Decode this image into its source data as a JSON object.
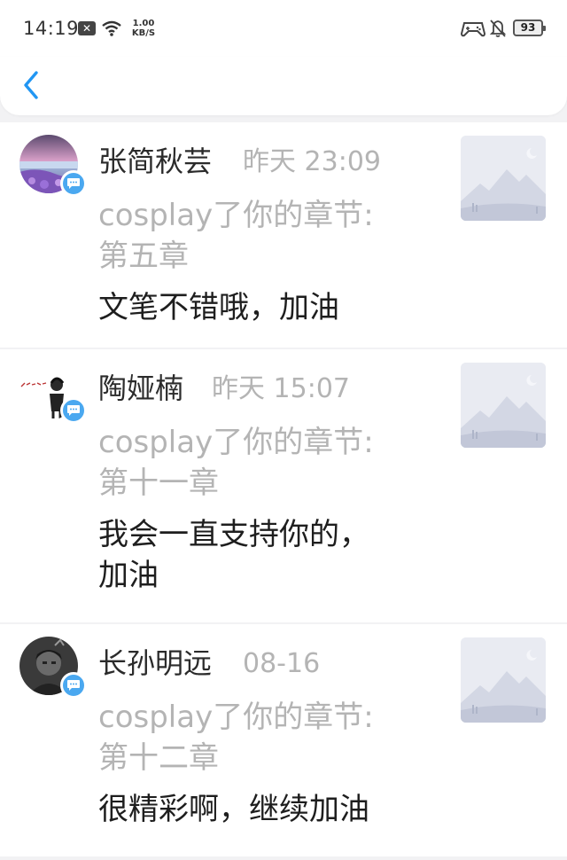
{
  "status_bar": {
    "time": "14:19",
    "speed_value": "1.00",
    "speed_unit": "KB/S",
    "battery": "93"
  },
  "notifications": [
    {
      "name": "张简秋芸",
      "time": "昨天 23:09",
      "action_line1": "cosplay了你的章节:",
      "action_line2": "第五章",
      "comment_line1": "文笔不错哦，加油",
      "comment_line2": ""
    },
    {
      "name": "陶娅楠",
      "time": "昨天 15:07",
      "action_line1": "cosplay了你的章节:",
      "action_line2": "第十一章",
      "comment_line1": "我会一直支持你的，",
      "comment_line2": "加油"
    },
    {
      "name": "长孙明远",
      "time": "08-16",
      "action_line1": "cosplay了你的章节:",
      "action_line2": "第十二章",
      "comment_line1": "很精彩啊，继续加油",
      "comment_line2": ""
    }
  ],
  "colors": {
    "accent": "#2196f3",
    "badge": "#4aa8f0",
    "muted_text": "#b4b4b4",
    "background": "#f2f2f4"
  }
}
